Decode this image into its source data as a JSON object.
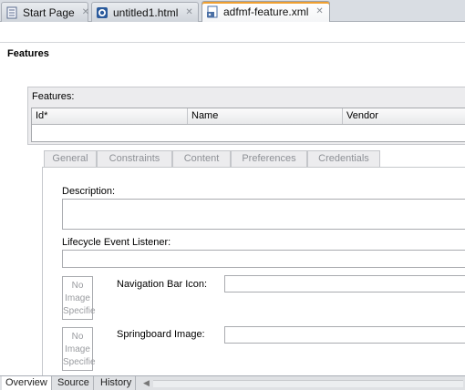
{
  "tabs": [
    {
      "label": "Start Page",
      "icon": "document-icon",
      "close": "✕",
      "active": false
    },
    {
      "label": "untitled1.html",
      "icon": "html-file-icon",
      "close": "✕",
      "active": false
    },
    {
      "label": "adfmf-feature.xml",
      "icon": "xml-file-icon",
      "close": "✕",
      "active": true
    }
  ],
  "page": {
    "heading": "Features"
  },
  "features": {
    "caption": "Features:",
    "columns": [
      "Id*",
      "Name",
      "Vendor"
    ]
  },
  "subtabs": [
    "General",
    "Constraints",
    "Content",
    "Preferences",
    "Credentials"
  ],
  "general": {
    "description_label": "Description:",
    "lifecycle_label": "Lifecycle Event Listener:",
    "navbar_icon_label": "Navigation Bar Icon:",
    "springboard_label": "Springboard Image:",
    "no_image_text": "No Image Specifie"
  },
  "bottom_tabs": [
    {
      "label": "Overview",
      "active": true
    },
    {
      "label": "Source",
      "active": false
    },
    {
      "label": "History",
      "active": false
    }
  ],
  "scroll_left_glyph": "◀",
  "colors": {
    "active_tab_accent": "#f0a030",
    "disabled_text": "#8e9196"
  }
}
